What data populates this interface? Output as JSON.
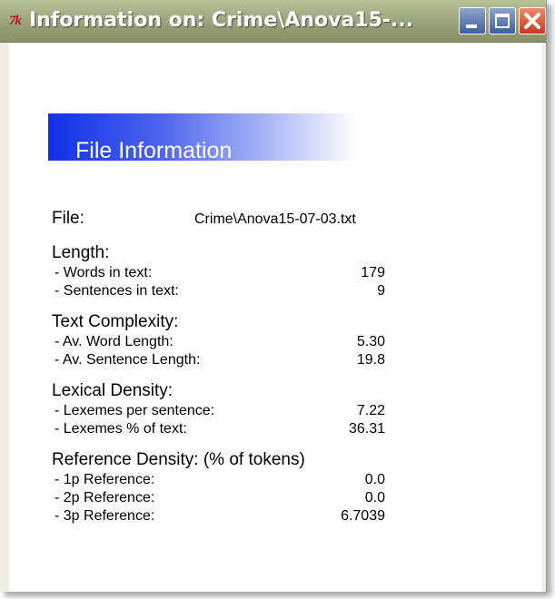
{
  "window": {
    "title": "Information on: Crime\\Anova15-...",
    "app_icon": "tk-feather-icon",
    "controls": [
      "minimize-icon",
      "maximize-icon",
      "close-icon"
    ]
  },
  "banner": {
    "title": "File Information"
  },
  "file": {
    "label": "File:",
    "value": "Crime\\Anova15-07-03.txt"
  },
  "length": {
    "heading": "Length:",
    "items": [
      {
        "label": "- Words in text:",
        "value": "179"
      },
      {
        "label": "- Sentences in text:",
        "value": "9"
      }
    ]
  },
  "complexity": {
    "heading": "Text Complexity:",
    "items": [
      {
        "label": "- Av. Word Length:",
        "value": "5.30"
      },
      {
        "label": "- Av. Sentence Length:",
        "value": "19.8"
      }
    ]
  },
  "lexical": {
    "heading": "Lexical Density:",
    "items": [
      {
        "label": "- Lexemes per sentence:",
        "value": "7.22"
      },
      {
        "label": "- Lexemes % of text:",
        "value": "36.31"
      }
    ]
  },
  "reference": {
    "heading": "Reference Density: (% of tokens)",
    "items": [
      {
        "label": "- 1p Reference:",
        "value": "0.0"
      },
      {
        "label": "- 2p Reference:",
        "value": "0.0"
      },
      {
        "label": "- 3p Reference:",
        "value": "6.7039"
      }
    ]
  },
  "colors": {
    "banner_blue": "#1030e6",
    "titlebar_olive": "#a4ad85",
    "close_red": "#c9391c"
  }
}
